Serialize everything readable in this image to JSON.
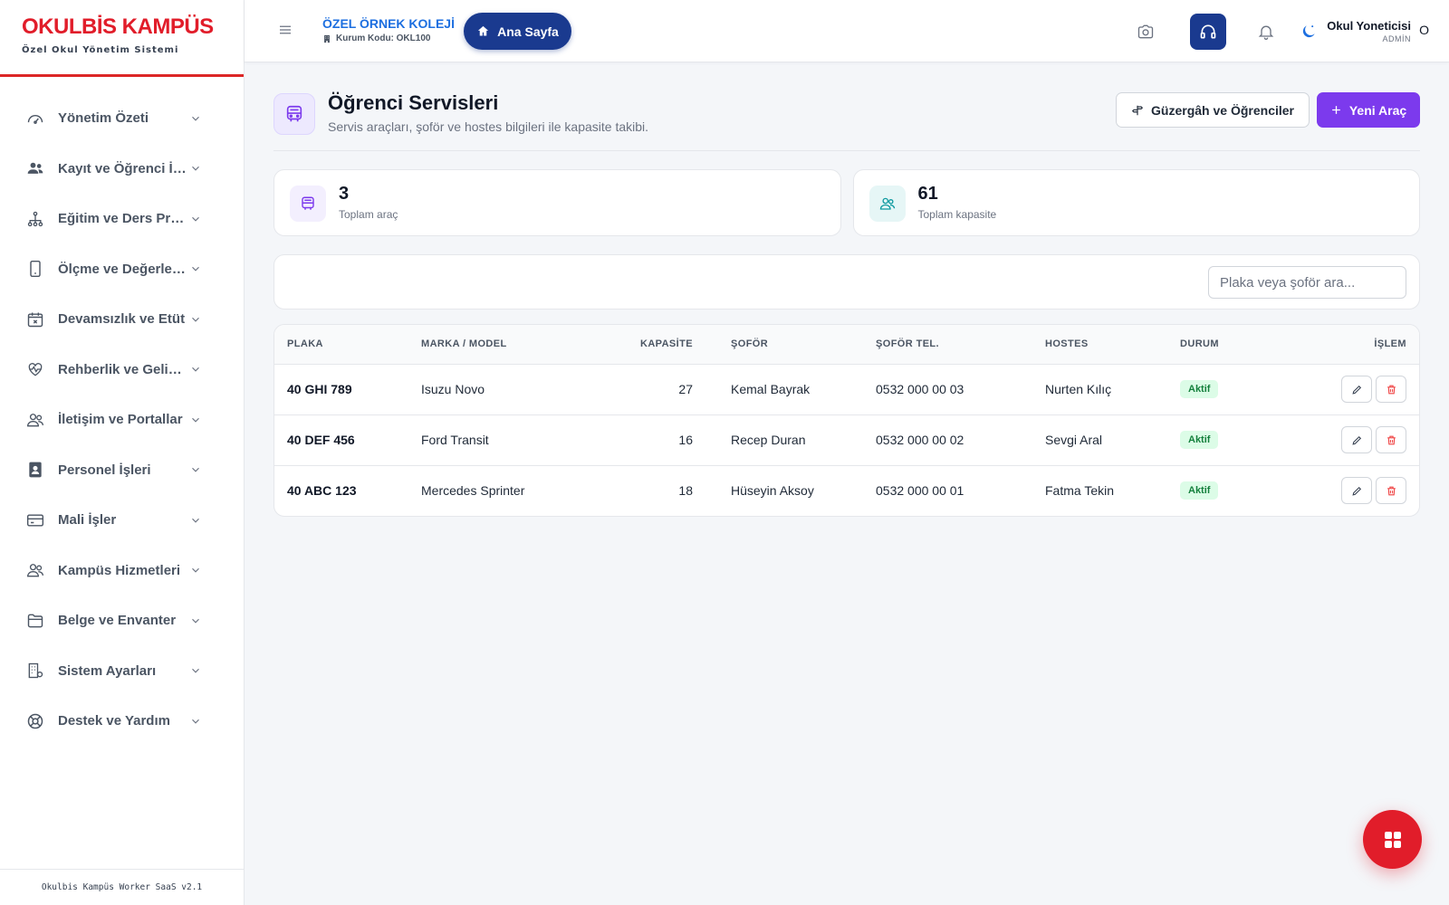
{
  "brand": {
    "title": "OKULBİS KAMPÜS",
    "subtitle": "Özel Okul Yönetim Sistemi",
    "footer": "Okulbis Kampüs Worker SaaS v2.1"
  },
  "sidebar": {
    "items": [
      {
        "label": "Yönetim Özeti",
        "icon": "gauge-icon"
      },
      {
        "label": "Kayıt ve Öğrenci İşlemleri",
        "icon": "users-icon"
      },
      {
        "label": "Eğitim ve Ders Programları",
        "icon": "hierarchy-icon"
      },
      {
        "label": "Ölçme ve Değerlendirme",
        "icon": "phone-icon"
      },
      {
        "label": "Devamsızlık ve Etüt",
        "icon": "calendar-x-icon"
      },
      {
        "label": "Rehberlik ve Gelişim",
        "icon": "heart-pulse-icon"
      },
      {
        "label": "İletişim ve Portallar",
        "icon": "people-icon"
      },
      {
        "label": "Personel İşleri",
        "icon": "id-badge-icon"
      },
      {
        "label": "Mali İşler",
        "icon": "credit-card-icon"
      },
      {
        "label": "Kampüs Hizmetleri",
        "icon": "people-icon"
      },
      {
        "label": "Belge ve Envanter",
        "icon": "folder-icon"
      },
      {
        "label": "Sistem Ayarları",
        "icon": "building-gear-icon"
      },
      {
        "label": "Destek ve Yardım",
        "icon": "lifebuoy-icon"
      }
    ]
  },
  "header": {
    "school_name": "ÖZEL ÖRNEK KOLEJİ",
    "school_code": "Kurum Kodu: OKL100",
    "home_label": "Ana Sayfa",
    "user_name": "Okul Yoneticisi",
    "user_role": "ADMİN",
    "user_initial": "O"
  },
  "page": {
    "title": "Öğrenci Servisleri",
    "subtitle": "Servis araçları, şoför ve hostes bilgileri ile kapasite takibi.",
    "route_button": "Güzergâh ve Öğrenciler",
    "new_button": "Yeni Araç"
  },
  "stats": [
    {
      "value": "3",
      "label": "Toplam araç"
    },
    {
      "value": "61",
      "label": "Toplam kapasite"
    }
  ],
  "search": {
    "placeholder": "Plaka veya şoför ara...",
    "value": ""
  },
  "table": {
    "headers": [
      "PLAKA",
      "MARKA / MODEL",
      "KAPASİTE",
      "ŞOFÖR",
      "ŞOFÖR TEL.",
      "HOSTES",
      "DURUM",
      "İŞLEM"
    ],
    "rows": [
      {
        "plate": "40 GHI 789",
        "model": "Isuzu Novo",
        "capacity": "27",
        "driver": "Kemal Bayrak",
        "phone": "0532 000 00 03",
        "hostess": "Nurten Kılıç",
        "status": "Aktif"
      },
      {
        "plate": "40 DEF 456",
        "model": "Ford Transit",
        "capacity": "16",
        "driver": "Recep Duran",
        "phone": "0532 000 00 02",
        "hostess": "Sevgi Aral",
        "status": "Aktif"
      },
      {
        "plate": "40 ABC 123",
        "model": "Mercedes Sprinter",
        "capacity": "18",
        "driver": "Hüseyin Aksoy",
        "phone": "0532 000 00 01",
        "hostess": "Fatma Tekin",
        "status": "Aktif"
      }
    ]
  },
  "colors": {
    "brand_red": "#e11d2a",
    "navy": "#1a3a8f",
    "accent_purple": "#7c3aed",
    "link_blue": "#1d6fe0",
    "status_green": "#15803d"
  }
}
